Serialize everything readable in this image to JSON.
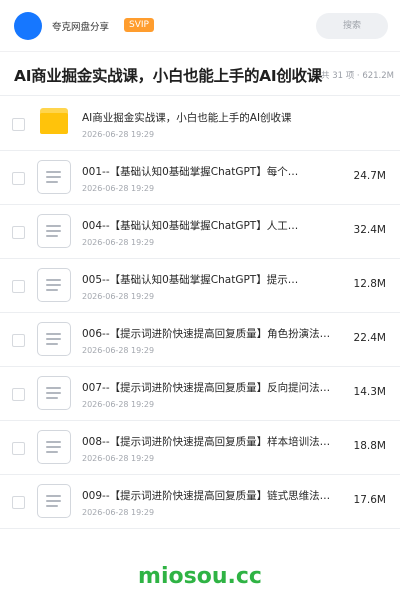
{
  "header": {
    "owner_name": "夸克网盘分享",
    "badge": "SVIP",
    "search_placeholder": "搜索"
  },
  "share": {
    "title": "AI商业掘金实战课，小白也能上手的AI创收课",
    "meta": "共 31 项 · 621.2M"
  },
  "files": [
    {
      "type": "folder",
      "name": "AI商业掘金实战课，小白也能上手的AI创收课",
      "date": "2026-06-28 19:29",
      "size": ""
    },
    {
      "type": "file",
      "name": "001--【基础认知0基础掌握ChatGPT】每个…",
      "date": "2026-06-28 19:29",
      "size": "24.7M"
    },
    {
      "type": "file",
      "name": "004--【基础认知0基础掌握ChatGPT】人工…",
      "date": "2026-06-28 19:29",
      "size": "32.4M"
    },
    {
      "type": "file",
      "name": "005--【基础认知0基础掌握ChatGPT】提示…",
      "date": "2026-06-28 19:29",
      "size": "12.8M"
    },
    {
      "type": "file",
      "name": "006--【提示词进阶快速提高回复质量】角色扮演法…",
      "date": "2026-06-28 19:29",
      "size": "22.4M"
    },
    {
      "type": "file",
      "name": "007--【提示词进阶快速提高回复质量】反向提问法…",
      "date": "2026-06-28 19:29",
      "size": "14.3M"
    },
    {
      "type": "file",
      "name": "008--【提示词进阶快速提高回复质量】样本培训法…",
      "date": "2026-06-28 19:29",
      "size": "18.8M"
    },
    {
      "type": "file",
      "name": "009--【提示词进阶快速提高回复质量】链式思维法…",
      "date": "2026-06-28 19:29",
      "size": "17.6M"
    }
  ],
  "footer": {
    "brand": "miosou.cc"
  },
  "colors": {
    "avatar": "#1677ff",
    "svip_badge": "#ff9d2e",
    "folder": "#ffc30b",
    "brand_green": "#2fb344"
  },
  "icons": {
    "folder": "folder-icon",
    "file": "document-icon"
  }
}
